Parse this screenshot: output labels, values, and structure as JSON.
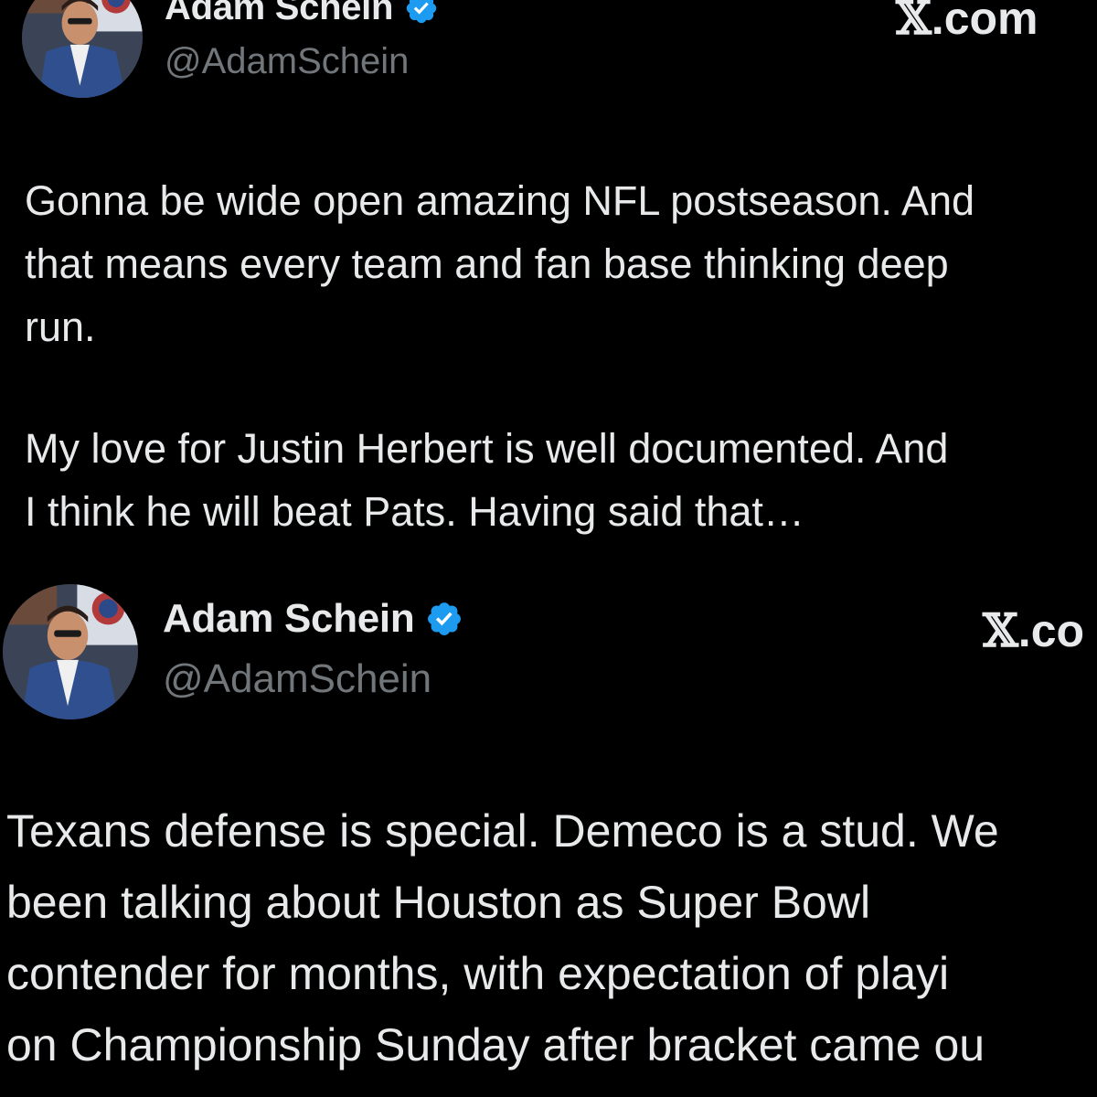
{
  "tweets": [
    {
      "display_name": "Adam Schein",
      "handle": "@AdamSchein",
      "site": ".com",
      "site_icon": "x-logo-icon",
      "verified": true,
      "paragraphs": [
        [
          "Gonna be wide open amazing NFL postseason. And",
          "that means every team and fan base thinking deep",
          "run."
        ],
        [
          "My love for Justin Herbert is well documented. And",
          "I think he will beat Pats. Having said that…"
        ]
      ]
    },
    {
      "display_name": "Adam Schein",
      "handle": "@AdamSchein",
      "site": ".co",
      "site_icon": "x-logo-icon",
      "verified": true,
      "paragraphs": [
        [
          "Texans defense is special. Demeco is a stud. We",
          "been talking about Houston as Super Bowl",
          "contender for months, with expectation of playi",
          "on Championship Sunday after bracket came ou"
        ]
      ]
    }
  ],
  "colors": {
    "background": "#000000",
    "text": "#e7e9ea",
    "secondary_text": "#71767b",
    "verified_badge": "#1d9bf0"
  }
}
